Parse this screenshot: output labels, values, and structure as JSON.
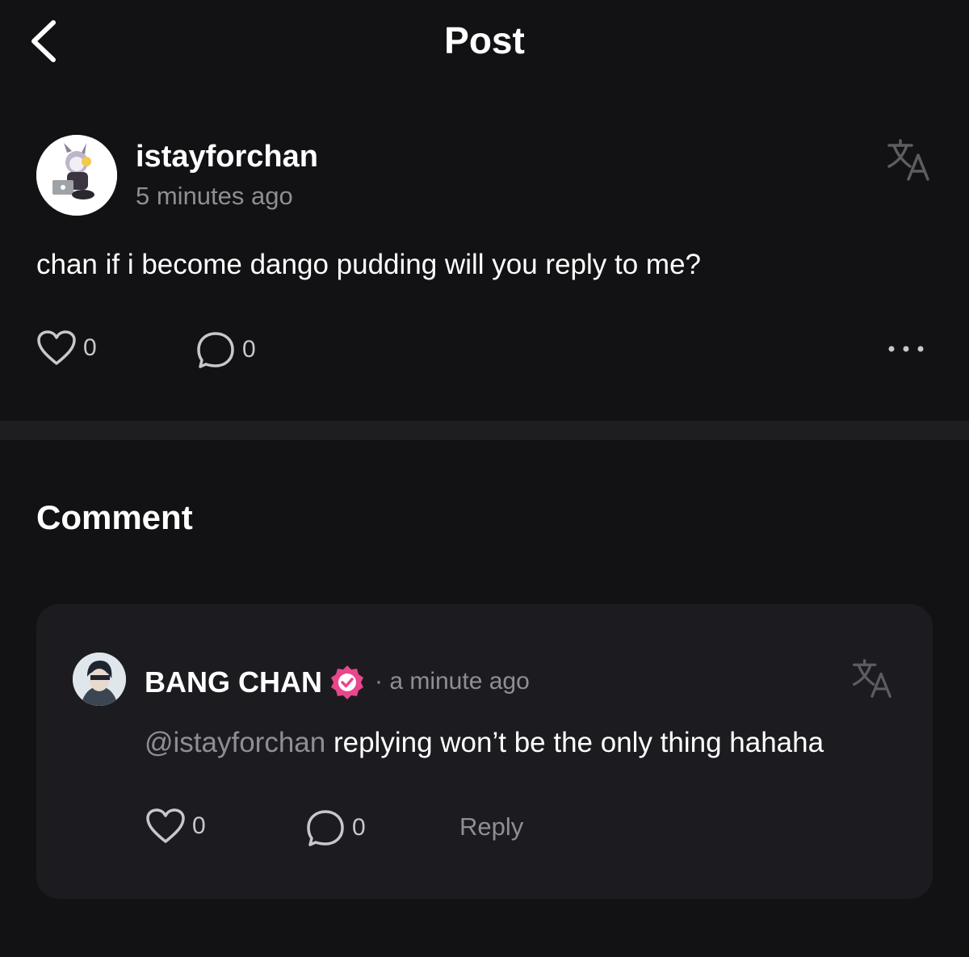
{
  "header": {
    "title": "Post"
  },
  "post": {
    "username": "istayforchan",
    "time": "5 minutes ago",
    "text": "chan if i become dango pudding will you reply to me?",
    "likes": "0",
    "comments": "0"
  },
  "comments_section": {
    "title": "Comment"
  },
  "comment": {
    "username": "BANG CHAN",
    "verified": true,
    "meta": "· a minute ago",
    "mention": "@istayforchan",
    "text": " replying won’t be the only thing hahaha",
    "likes": "0",
    "comments": "0",
    "reply_label": "Reply"
  },
  "colors": {
    "background": "#121214",
    "card": "#1c1c20",
    "muted_text": "#8e8e93",
    "verified_badge": "#e8478b"
  },
  "icons": [
    "chevron-left-icon",
    "translate-icon",
    "heart-icon",
    "speech-bubble-icon",
    "more-horizontal-icon",
    "verified-badge-icon"
  ]
}
